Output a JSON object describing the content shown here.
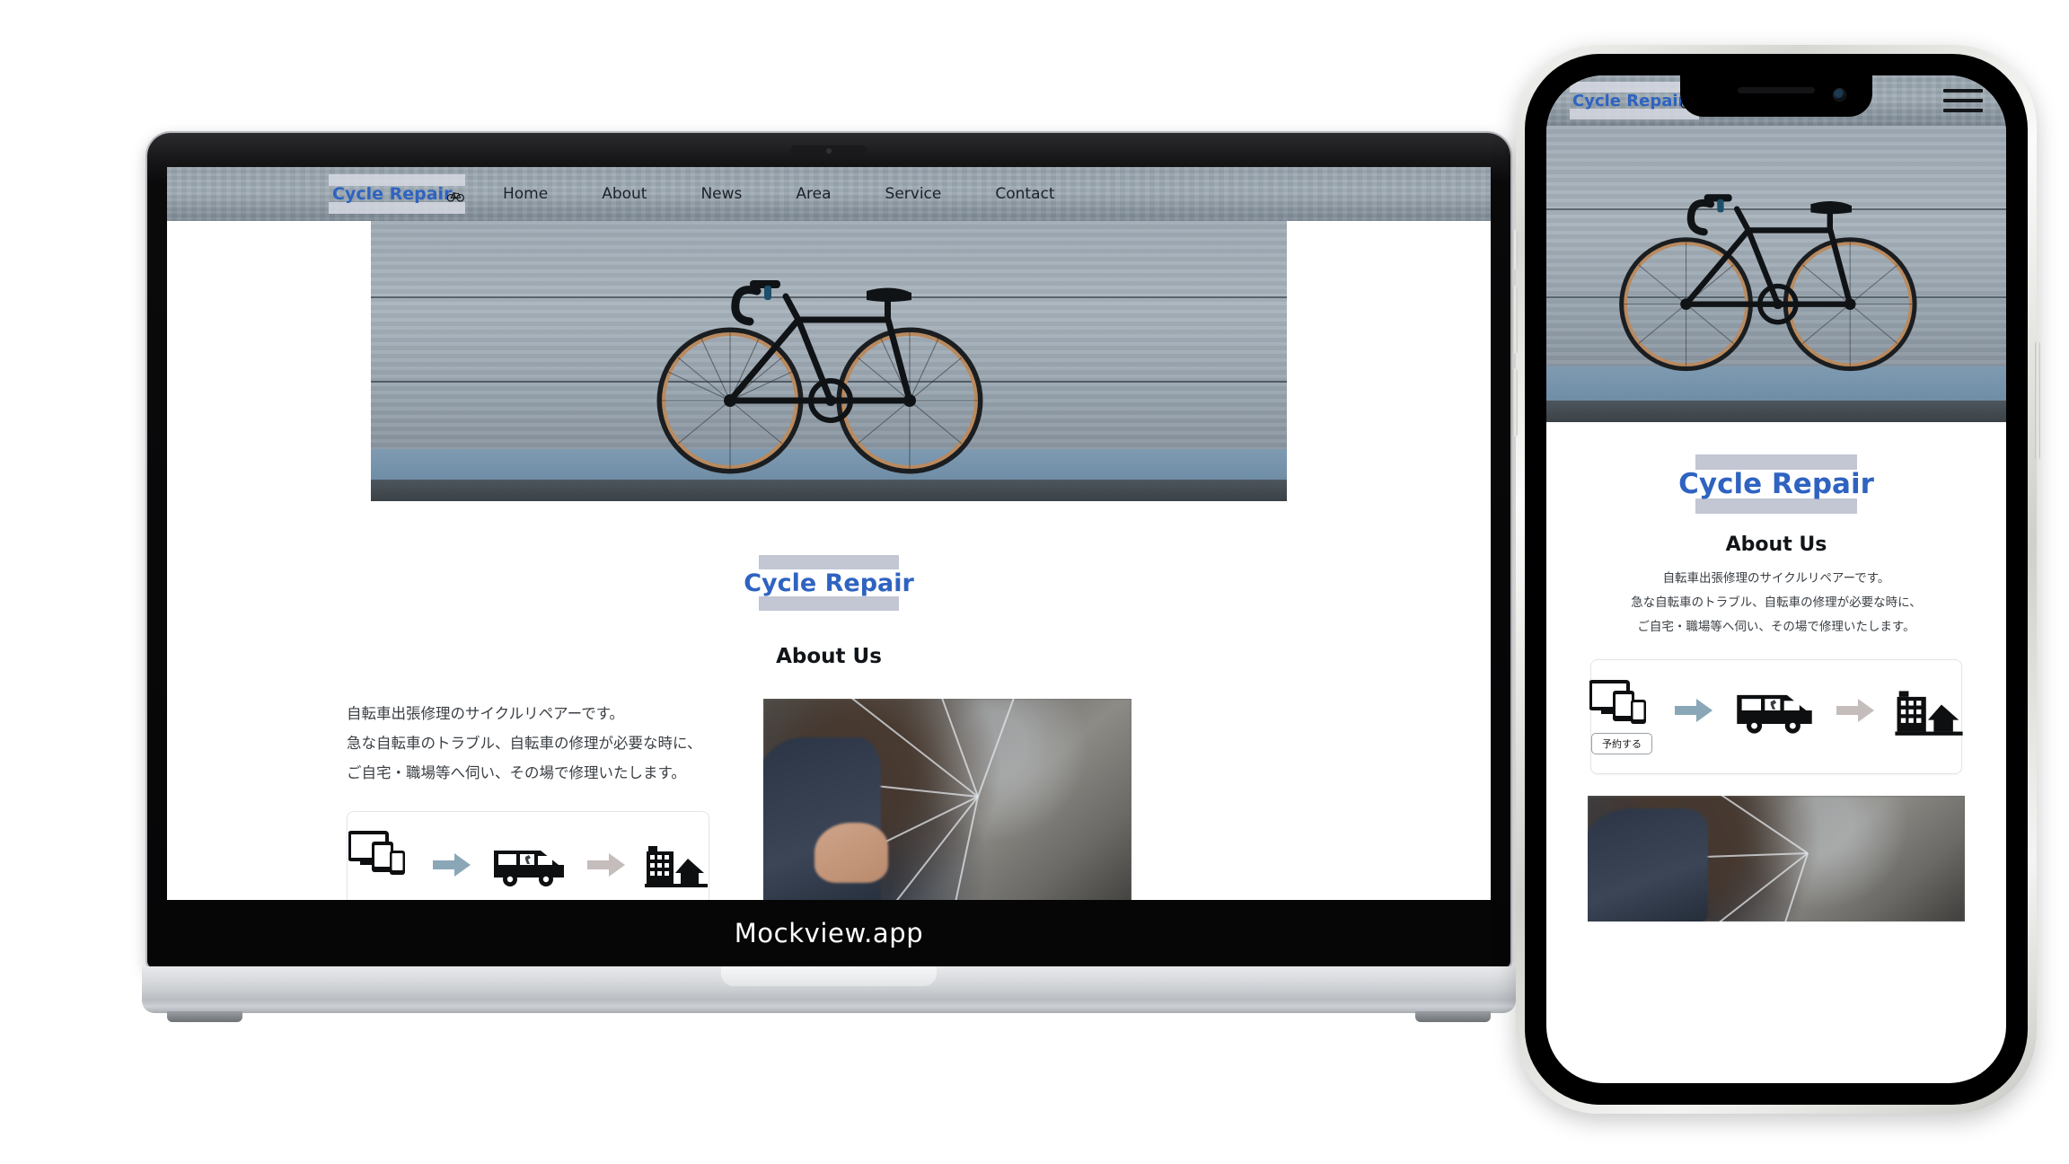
{
  "mock": {
    "watermark": "Mockview.app"
  },
  "site": {
    "logo": {
      "text": "Cycle Repair",
      "icon": "bicycle-icon"
    },
    "nav": [
      {
        "label": "Home"
      },
      {
        "label": "About"
      },
      {
        "label": "News"
      },
      {
        "label": "Area"
      },
      {
        "label": "Service"
      },
      {
        "label": "Contact"
      }
    ],
    "mobile_menu_icon": "hamburger-menu-icon",
    "hero": {
      "image_alt": "black fixed-gear bicycle leaning against a concrete wall"
    },
    "headline": "Cycle Repair",
    "about": {
      "title": "About Us",
      "lines": [
        "自転車出張修理のサイクルリペアーです。",
        "急な自転車のトラブル、自転車の修理が必要な時に、",
        "ご自宅・職場等へ伺い、その場で修理いたします。"
      ]
    },
    "flow": {
      "reserve_label": "予約する",
      "steps": [
        {
          "icon": "devices-icon",
          "name": "devices"
        },
        {
          "icon": "arrow-right-icon",
          "name": "arrow-blue"
        },
        {
          "icon": "van-icon",
          "name": "repair-van"
        },
        {
          "icon": "arrow-right-icon",
          "name": "arrow-gray"
        },
        {
          "icon": "buildings-icon",
          "name": "buildings-home"
        }
      ]
    },
    "repair_image_alt": "hand repairing a bicycle wheel"
  },
  "colors": {
    "brand_blue": "#2f63c1",
    "highlight_bar": "#c3c7d4",
    "logo_bar": "#d6d9e2",
    "arrow_blue": "#8aa7b7",
    "arrow_gray": "#c5bdbb",
    "text_dark": "#111418",
    "body_text": "#3a3f44"
  }
}
